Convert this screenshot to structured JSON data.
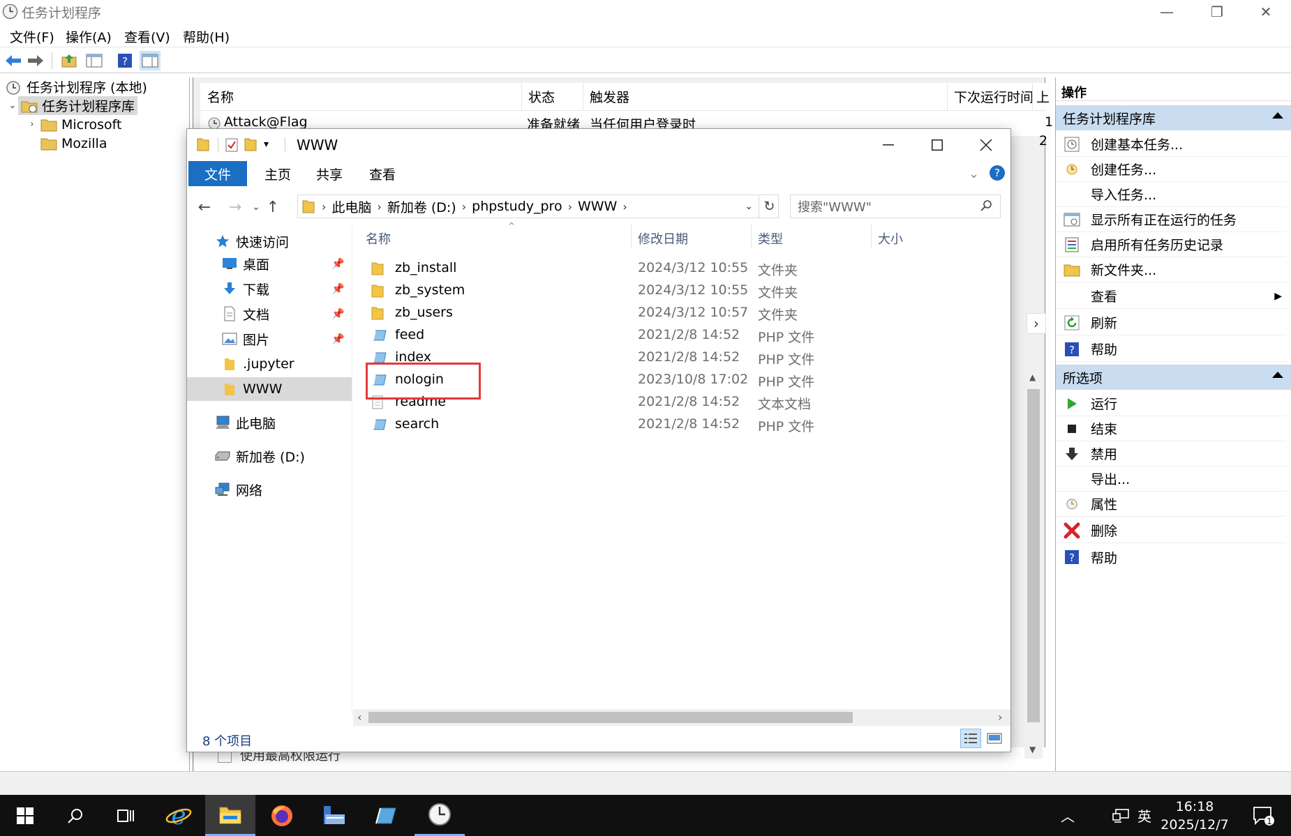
{
  "scheduler": {
    "title": "任务计划程序",
    "menu": [
      "文件(F)",
      "操作(A)",
      "查看(V)",
      "帮助(H)"
    ],
    "tree": {
      "root": "任务计划程序 (本地)",
      "library": "任务计划程序库",
      "children": [
        "Microsoft",
        "Mozilla"
      ]
    },
    "task_columns": [
      "名称",
      "状态",
      "触发器",
      "下次运行时间",
      "上"
    ],
    "task": {
      "name": "Attack@Flag",
      "status": "准备就绪",
      "trigger": "当任何用户登录时",
      "extra1": "1",
      "extra2": "2"
    },
    "bottom_text": "使用最高权限运行",
    "actions": {
      "header": "操作",
      "section1": "任务计划程序库",
      "items1": [
        "创建基本任务...",
        "创建任务...",
        "导入任务...",
        "显示所有正在运行的任务",
        "启用所有任务历史记录",
        "新文件夹...",
        "查看",
        "刷新",
        "帮助"
      ],
      "section2": "所选项",
      "items2": [
        "运行",
        "结束",
        "禁用",
        "导出...",
        "属性",
        "删除",
        "帮助"
      ]
    }
  },
  "explorer": {
    "title": "WWW",
    "ribbon_tabs": [
      "文件",
      "主页",
      "共享",
      "查看"
    ],
    "address": [
      "此电脑",
      "新加卷 (D:)",
      "phpstudy_pro",
      "WWW"
    ],
    "search_placeholder": "搜索\"WWW\"",
    "nav": {
      "quick_access": "快速访问",
      "pinned": [
        "桌面",
        "下载",
        "文档",
        "图片"
      ],
      "others": [
        ".jupyter",
        "WWW"
      ],
      "this_pc": "此电脑",
      "drive": "新加卷 (D:)",
      "network": "网络"
    },
    "columns": [
      "名称",
      "修改日期",
      "类型",
      "大小"
    ],
    "files": [
      {
        "name": "zb_install",
        "date": "2024/3/12 10:55",
        "type": "文件夹",
        "icon": "folder-icon"
      },
      {
        "name": "zb_system",
        "date": "2024/3/12 10:55",
        "type": "文件夹",
        "icon": "folder-icon"
      },
      {
        "name": "zb_users",
        "date": "2024/3/12 10:57",
        "type": "文件夹",
        "icon": "folder-icon"
      },
      {
        "name": "feed",
        "date": "2021/2/8 14:52",
        "type": "PHP 文件",
        "icon": "php-file-icon"
      },
      {
        "name": "index",
        "date": "2021/2/8 14:52",
        "type": "PHP 文件",
        "icon": "php-file-icon"
      },
      {
        "name": "nologin",
        "date": "2023/10/8 17:02",
        "type": "PHP 文件",
        "icon": "php-file-icon"
      },
      {
        "name": "readme",
        "date": "2021/2/8 14:52",
        "type": "文本文档",
        "icon": "text-file-icon"
      },
      {
        "name": "search",
        "date": "2021/2/8 14:52",
        "type": "PHP 文件",
        "icon": "php-file-icon"
      }
    ],
    "status": "8 个项目"
  },
  "taskbar": {
    "time": "16:18",
    "date": "2025/12/7",
    "ime": "英",
    "notification_count": "1"
  },
  "colors": {
    "accent": "#1a6fc4",
    "highlight_box": "#e5383b",
    "section_bg": "#c9dcf0",
    "taskbar": "#101010"
  }
}
